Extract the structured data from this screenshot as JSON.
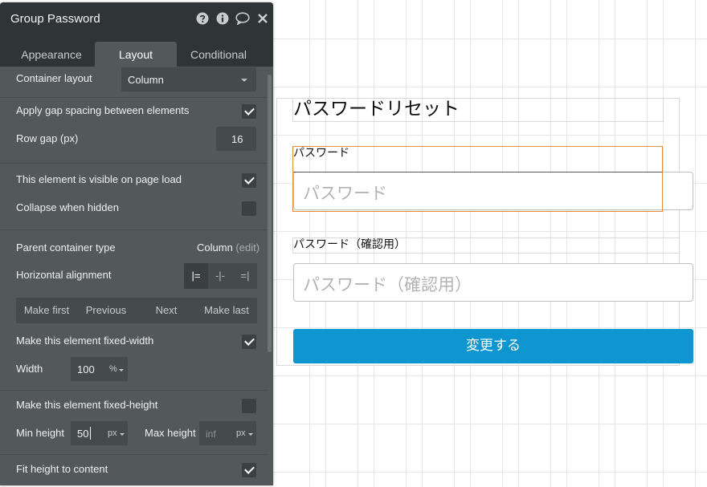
{
  "panel": {
    "title": "Group Password",
    "header_icons": [
      "help-icon",
      "info-icon",
      "comment-icon",
      "close-icon"
    ],
    "tabs": [
      {
        "label": "Appearance",
        "active": false
      },
      {
        "label": "Layout",
        "active": true
      },
      {
        "label": "Conditional",
        "active": false
      }
    ],
    "container_layout": {
      "label": "Container layout",
      "value": "Column"
    },
    "gap_spacing": {
      "label": "Apply gap spacing between elements",
      "checked": true
    },
    "row_gap": {
      "label": "Row gap (px)",
      "value": "16"
    },
    "visible_on_load": {
      "label": "This element is visible on page load",
      "checked": true
    },
    "collapse_hidden": {
      "label": "Collapse when hidden",
      "checked": false
    },
    "parent_container": {
      "label": "Parent container type",
      "value": "Column",
      "edit": "(edit)"
    },
    "horizontal_alignment": {
      "label": "Horizontal alignment",
      "options": [
        "align-left-icon",
        "align-center-icon",
        "align-right-icon"
      ],
      "selected": "left"
    },
    "order_buttons": [
      "Make first",
      "Previous",
      "Next",
      "Make last"
    ],
    "fixed_width": {
      "label": "Make this element fixed-width",
      "checked": true
    },
    "width": {
      "label": "Width",
      "value": "100",
      "unit": "%"
    },
    "fixed_height": {
      "label": "Make this element fixed-height",
      "checked": false
    },
    "min_height": {
      "label": "Min height",
      "value": "50",
      "unit": "px"
    },
    "max_height": {
      "label": "Max height",
      "placeholder": "inf",
      "unit": "px"
    },
    "fit_height": {
      "label": "Fit height to content",
      "checked": true
    }
  },
  "page": {
    "heading": "パスワードリセット",
    "password_label": "パスワード",
    "password_placeholder": "パスワード",
    "confirm_label": "パスワード（確認用）",
    "confirm_placeholder": "パスワード（確認用）",
    "submit_label": "変更する"
  },
  "colors": {
    "panel_bg": "#53595a",
    "panel_header": "#2f3436",
    "submit_button": "#0f96d1",
    "selection_outline": "#e38b3d"
  }
}
